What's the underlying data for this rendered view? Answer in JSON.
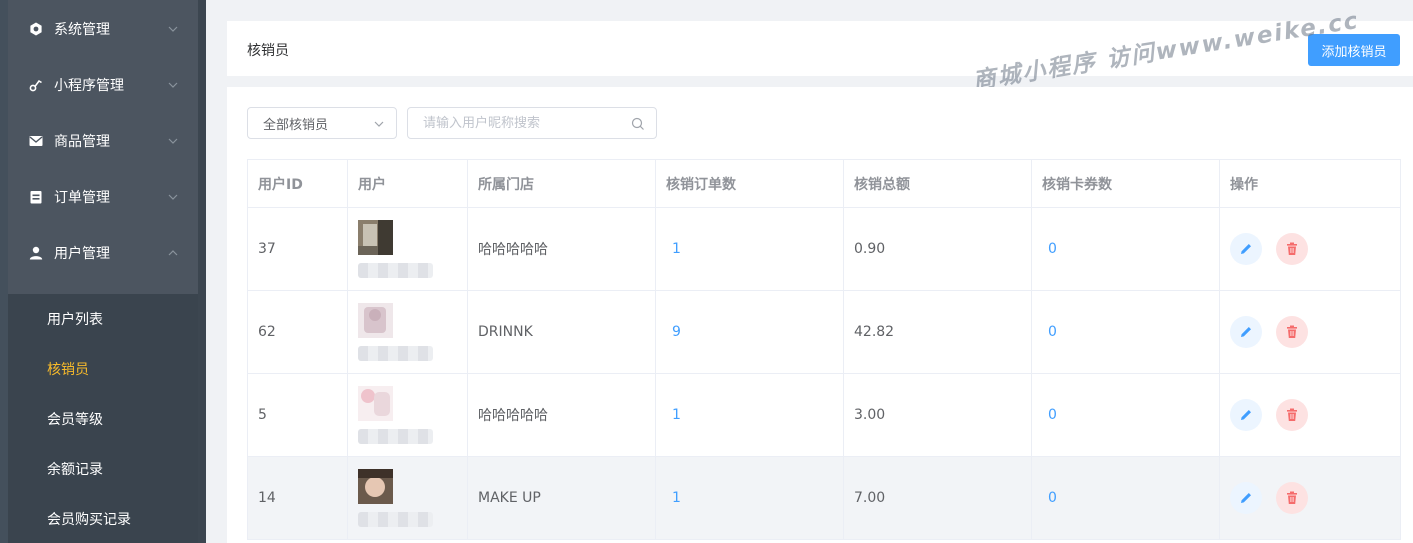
{
  "sidebar": {
    "menus": [
      {
        "label": "系统管理",
        "icon": "gear-icon"
      },
      {
        "label": "小程序管理",
        "icon": "link-icon"
      },
      {
        "label": "商品管理",
        "icon": "mail-icon"
      },
      {
        "label": "订单管理",
        "icon": "clipboard-icon"
      },
      {
        "label": "用户管理",
        "icon": "user-icon"
      }
    ],
    "sub_items": [
      {
        "label": "用户列表"
      },
      {
        "label": "核销员"
      },
      {
        "label": "会员等级"
      },
      {
        "label": "余额记录"
      },
      {
        "label": "会员购买记录"
      }
    ]
  },
  "header": {
    "title": "核销员",
    "add_button": "添加核销员",
    "watermark": "商城小程序 访问www.weike.cc"
  },
  "filter": {
    "select_value": "全部核销员",
    "search_placeholder": "请输入用户昵称搜索"
  },
  "table": {
    "columns": [
      "用户ID",
      "用户",
      "所属门店",
      "核销订单数",
      "核销总额",
      "核销卡券数",
      "操作"
    ],
    "rows": [
      {
        "id": "37",
        "store": "哈哈哈哈哈",
        "orders": "1",
        "total": "0.90",
        "coupons": "0"
      },
      {
        "id": "62",
        "store": "DRINNK",
        "orders": "9",
        "total": "42.82",
        "coupons": "0"
      },
      {
        "id": "5",
        "store": "哈哈哈哈哈",
        "orders": "1",
        "total": "3.00",
        "coupons": "0"
      },
      {
        "id": "14",
        "store": "MAKE UP",
        "orders": "1",
        "total": "7.00",
        "coupons": "0"
      }
    ]
  },
  "colors": {
    "primary": "#409eff",
    "active_menu": "#f7ba2a",
    "danger": "#f56c6c"
  }
}
